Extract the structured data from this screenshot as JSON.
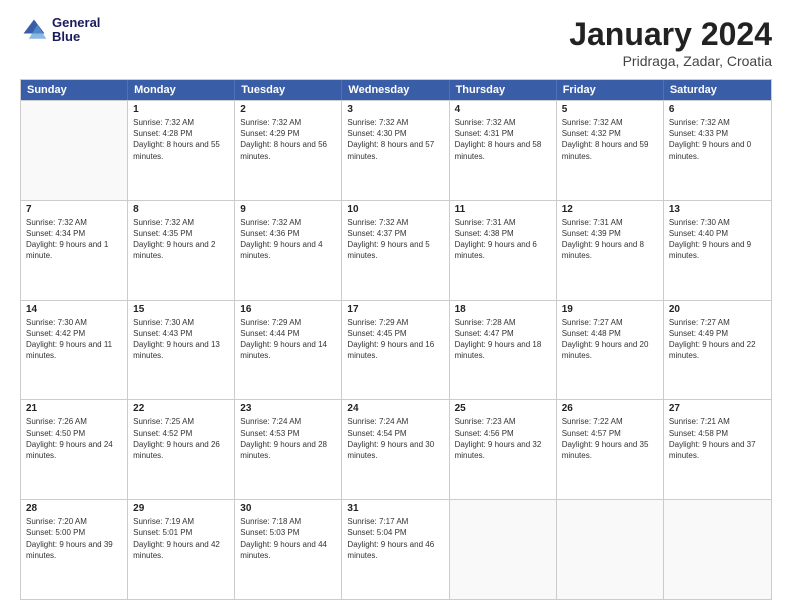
{
  "header": {
    "logo_line1": "General",
    "logo_line2": "Blue",
    "month": "January 2024",
    "location": "Pridraga, Zadar, Croatia"
  },
  "days_of_week": [
    "Sunday",
    "Monday",
    "Tuesday",
    "Wednesday",
    "Thursday",
    "Friday",
    "Saturday"
  ],
  "weeks": [
    [
      {
        "day": "",
        "empty": true
      },
      {
        "day": "1",
        "sunrise": "Sunrise: 7:32 AM",
        "sunset": "Sunset: 4:28 PM",
        "daylight": "Daylight: 8 hours and 55 minutes."
      },
      {
        "day": "2",
        "sunrise": "Sunrise: 7:32 AM",
        "sunset": "Sunset: 4:29 PM",
        "daylight": "Daylight: 8 hours and 56 minutes."
      },
      {
        "day": "3",
        "sunrise": "Sunrise: 7:32 AM",
        "sunset": "Sunset: 4:30 PM",
        "daylight": "Daylight: 8 hours and 57 minutes."
      },
      {
        "day": "4",
        "sunrise": "Sunrise: 7:32 AM",
        "sunset": "Sunset: 4:31 PM",
        "daylight": "Daylight: 8 hours and 58 minutes."
      },
      {
        "day": "5",
        "sunrise": "Sunrise: 7:32 AM",
        "sunset": "Sunset: 4:32 PM",
        "daylight": "Daylight: 8 hours and 59 minutes."
      },
      {
        "day": "6",
        "sunrise": "Sunrise: 7:32 AM",
        "sunset": "Sunset: 4:33 PM",
        "daylight": "Daylight: 9 hours and 0 minutes."
      }
    ],
    [
      {
        "day": "7",
        "sunrise": "Sunrise: 7:32 AM",
        "sunset": "Sunset: 4:34 PM",
        "daylight": "Daylight: 9 hours and 1 minute."
      },
      {
        "day": "8",
        "sunrise": "Sunrise: 7:32 AM",
        "sunset": "Sunset: 4:35 PM",
        "daylight": "Daylight: 9 hours and 2 minutes."
      },
      {
        "day": "9",
        "sunrise": "Sunrise: 7:32 AM",
        "sunset": "Sunset: 4:36 PM",
        "daylight": "Daylight: 9 hours and 4 minutes."
      },
      {
        "day": "10",
        "sunrise": "Sunrise: 7:32 AM",
        "sunset": "Sunset: 4:37 PM",
        "daylight": "Daylight: 9 hours and 5 minutes."
      },
      {
        "day": "11",
        "sunrise": "Sunrise: 7:31 AM",
        "sunset": "Sunset: 4:38 PM",
        "daylight": "Daylight: 9 hours and 6 minutes."
      },
      {
        "day": "12",
        "sunrise": "Sunrise: 7:31 AM",
        "sunset": "Sunset: 4:39 PM",
        "daylight": "Daylight: 9 hours and 8 minutes."
      },
      {
        "day": "13",
        "sunrise": "Sunrise: 7:30 AM",
        "sunset": "Sunset: 4:40 PM",
        "daylight": "Daylight: 9 hours and 9 minutes."
      }
    ],
    [
      {
        "day": "14",
        "sunrise": "Sunrise: 7:30 AM",
        "sunset": "Sunset: 4:42 PM",
        "daylight": "Daylight: 9 hours and 11 minutes."
      },
      {
        "day": "15",
        "sunrise": "Sunrise: 7:30 AM",
        "sunset": "Sunset: 4:43 PM",
        "daylight": "Daylight: 9 hours and 13 minutes."
      },
      {
        "day": "16",
        "sunrise": "Sunrise: 7:29 AM",
        "sunset": "Sunset: 4:44 PM",
        "daylight": "Daylight: 9 hours and 14 minutes."
      },
      {
        "day": "17",
        "sunrise": "Sunrise: 7:29 AM",
        "sunset": "Sunset: 4:45 PM",
        "daylight": "Daylight: 9 hours and 16 minutes."
      },
      {
        "day": "18",
        "sunrise": "Sunrise: 7:28 AM",
        "sunset": "Sunset: 4:47 PM",
        "daylight": "Daylight: 9 hours and 18 minutes."
      },
      {
        "day": "19",
        "sunrise": "Sunrise: 7:27 AM",
        "sunset": "Sunset: 4:48 PM",
        "daylight": "Daylight: 9 hours and 20 minutes."
      },
      {
        "day": "20",
        "sunrise": "Sunrise: 7:27 AM",
        "sunset": "Sunset: 4:49 PM",
        "daylight": "Daylight: 9 hours and 22 minutes."
      }
    ],
    [
      {
        "day": "21",
        "sunrise": "Sunrise: 7:26 AM",
        "sunset": "Sunset: 4:50 PM",
        "daylight": "Daylight: 9 hours and 24 minutes."
      },
      {
        "day": "22",
        "sunrise": "Sunrise: 7:25 AM",
        "sunset": "Sunset: 4:52 PM",
        "daylight": "Daylight: 9 hours and 26 minutes."
      },
      {
        "day": "23",
        "sunrise": "Sunrise: 7:24 AM",
        "sunset": "Sunset: 4:53 PM",
        "daylight": "Daylight: 9 hours and 28 minutes."
      },
      {
        "day": "24",
        "sunrise": "Sunrise: 7:24 AM",
        "sunset": "Sunset: 4:54 PM",
        "daylight": "Daylight: 9 hours and 30 minutes."
      },
      {
        "day": "25",
        "sunrise": "Sunrise: 7:23 AM",
        "sunset": "Sunset: 4:56 PM",
        "daylight": "Daylight: 9 hours and 32 minutes."
      },
      {
        "day": "26",
        "sunrise": "Sunrise: 7:22 AM",
        "sunset": "Sunset: 4:57 PM",
        "daylight": "Daylight: 9 hours and 35 minutes."
      },
      {
        "day": "27",
        "sunrise": "Sunrise: 7:21 AM",
        "sunset": "Sunset: 4:58 PM",
        "daylight": "Daylight: 9 hours and 37 minutes."
      }
    ],
    [
      {
        "day": "28",
        "sunrise": "Sunrise: 7:20 AM",
        "sunset": "Sunset: 5:00 PM",
        "daylight": "Daylight: 9 hours and 39 minutes."
      },
      {
        "day": "29",
        "sunrise": "Sunrise: 7:19 AM",
        "sunset": "Sunset: 5:01 PM",
        "daylight": "Daylight: 9 hours and 42 minutes."
      },
      {
        "day": "30",
        "sunrise": "Sunrise: 7:18 AM",
        "sunset": "Sunset: 5:03 PM",
        "daylight": "Daylight: 9 hours and 44 minutes."
      },
      {
        "day": "31",
        "sunrise": "Sunrise: 7:17 AM",
        "sunset": "Sunset: 5:04 PM",
        "daylight": "Daylight: 9 hours and 46 minutes."
      },
      {
        "day": "",
        "empty": true
      },
      {
        "day": "",
        "empty": true
      },
      {
        "day": "",
        "empty": true
      }
    ]
  ]
}
